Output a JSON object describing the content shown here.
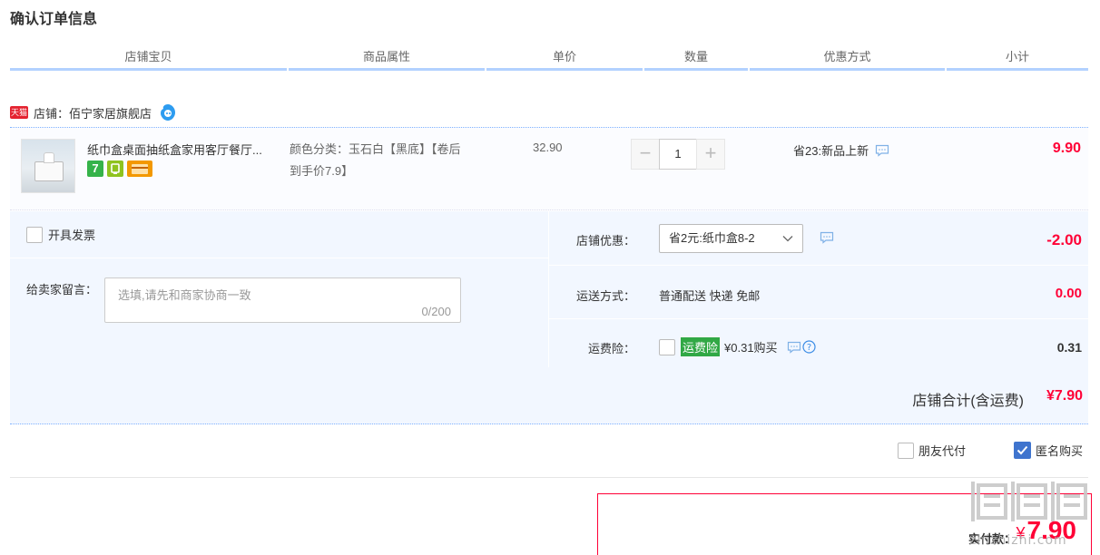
{
  "page": {
    "title": "确认订单信息"
  },
  "columns": [
    "店铺宝贝",
    "商品属性",
    "单价",
    "数量",
    "优惠方式",
    "小计"
  ],
  "shop": {
    "badge": "天猫",
    "label": "店铺：佰宁家居旗舰店",
    "chat_icon": "aliwangwang-icon"
  },
  "item": {
    "title": "纸巾盒桌面抽纸盒家用客厅餐厅...",
    "service_icons": [
      {
        "icon": "seven-day-return-icon",
        "text": "7",
        "color": "#35b34a"
      },
      {
        "icon": "guarantee-icon",
        "text": "",
        "color": "#8fc31f"
      },
      {
        "icon": "credit-card-icon",
        "text": "",
        "color": "#f39800"
      }
    ],
    "attr_line1": "颜色分类：玉石白【黑底】【卷后",
    "attr_line2": "到手价7.9】",
    "unit_price": "32.90",
    "quantity": "1",
    "qty_minus": "−",
    "qty_plus": "+",
    "promo": "省23:新品上新",
    "subtotal": "9.90"
  },
  "options": {
    "invoice_label": "开具发票",
    "message_label": "给卖家留言：",
    "message_placeholder": "选填,请先和商家协商一致",
    "message_count": "0/200",
    "shop_discount_label": "店铺优惠：",
    "shop_discount_value": "省2元:纸巾盒8-2",
    "shop_discount_amount": "-2.00",
    "shipping_label": "运送方式：",
    "shipping_value": "普通配送 快递 免邮",
    "shipping_amount": "0.00",
    "insurance_label": "运费险：",
    "insurance_badge": "运费险",
    "insurance_text": "¥0.31购买",
    "insurance_amount": "0.31"
  },
  "shop_total": {
    "label": "店铺合计(含运费)",
    "value": "¥7.90"
  },
  "checkout_options": {
    "friend_pay": "朋友代付",
    "anonymous": "匿名购买"
  },
  "payment": {
    "label": "实付款：",
    "currency": "¥",
    "amount": "7.90"
  },
  "watermark": {
    "url": "zhizhizhi.com"
  },
  "colors": {
    "accent": "#ff0036",
    "header_rule": "#b2d1ff",
    "panel_bg": "#f2f7ff",
    "checkbox_blue": "#3f74ce",
    "insurance_green": "#31a845"
  }
}
